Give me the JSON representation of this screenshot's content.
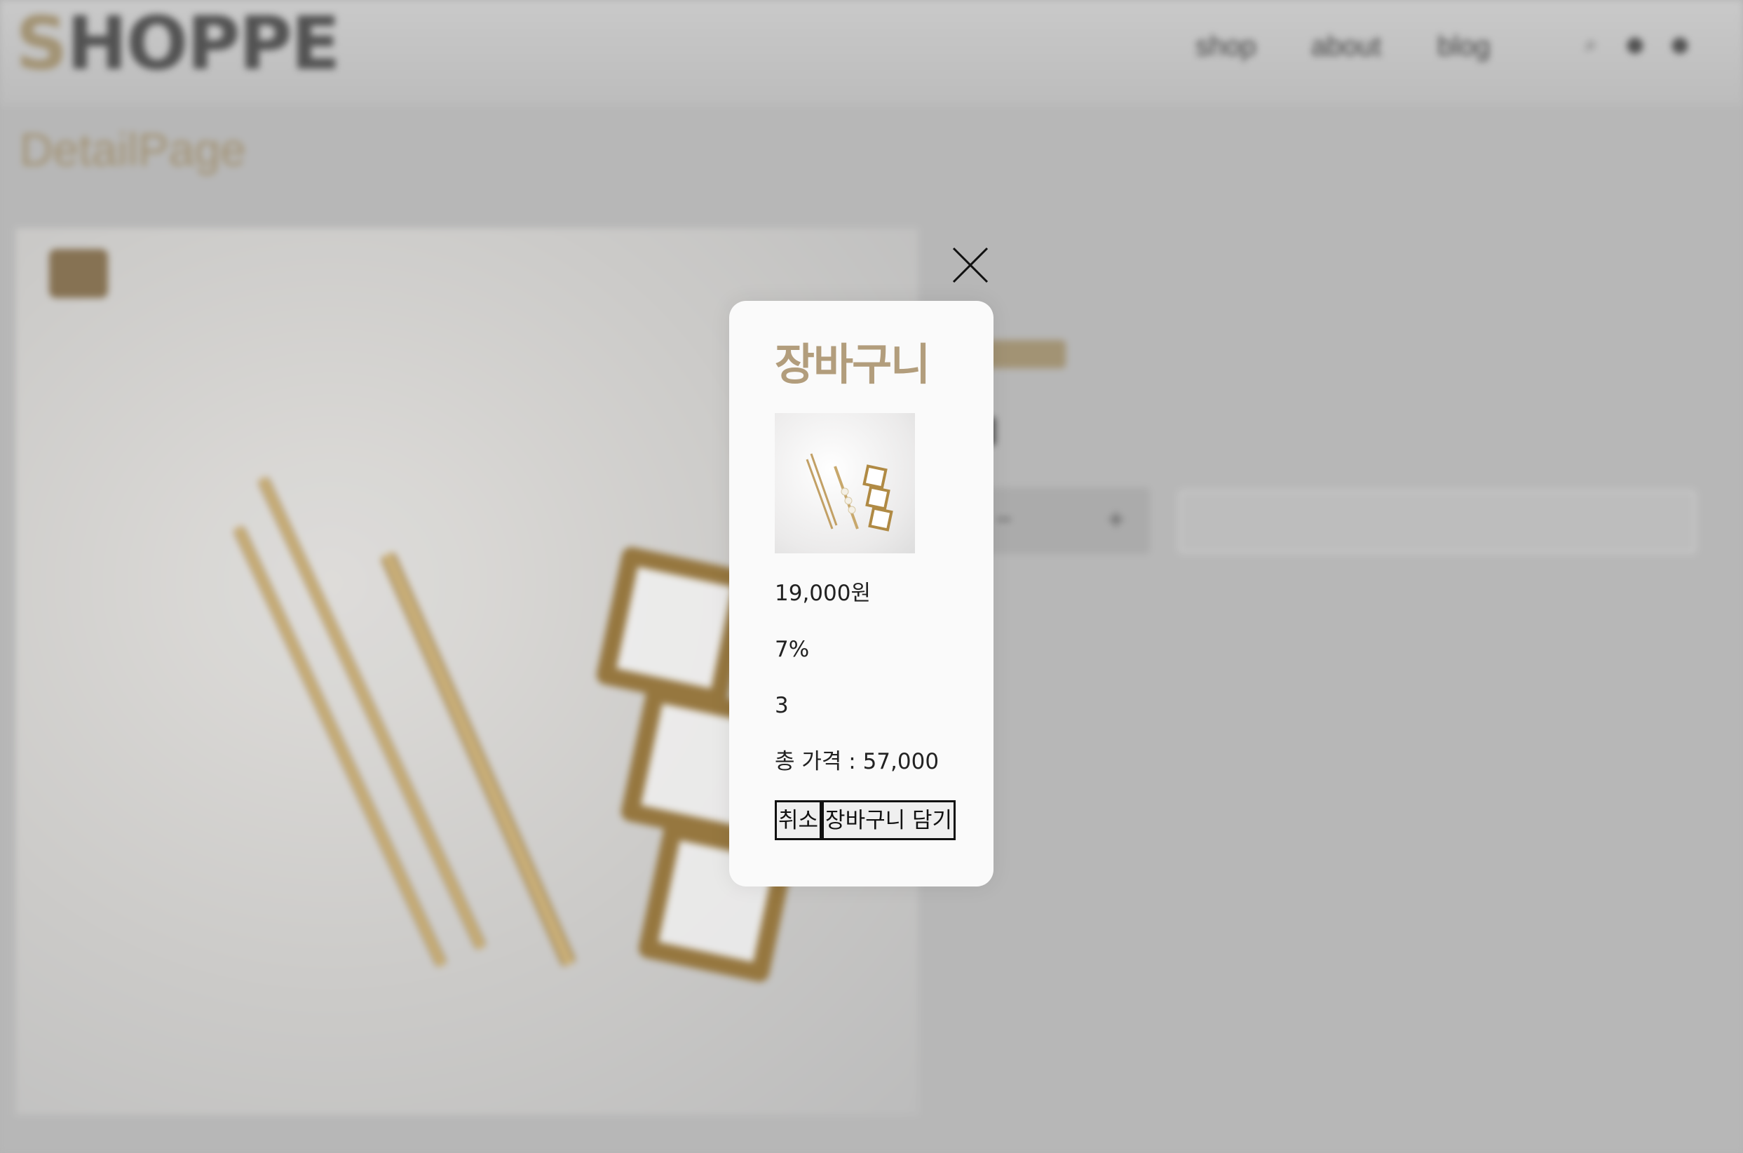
{
  "header": {
    "logo_text": "SHOPPE",
    "nav": [
      "shop",
      "about",
      "blog"
    ],
    "icons": [
      "search-icon",
      "cart-icon",
      "user-icon"
    ]
  },
  "page": {
    "heading": "DetailPage"
  },
  "modal": {
    "title": "장바구니",
    "price": "19,000원",
    "discount": "7%",
    "quantity": "3",
    "total": "총 가격 : 57,000",
    "cancel_label": "취소",
    "add_to_cart_label": "장바구니 담기",
    "close_icon": "close-icon"
  },
  "colors": {
    "accent": "#b29d7c",
    "modal_bg": "#fafafa",
    "overlay_bg": "#bdbdbd"
  }
}
